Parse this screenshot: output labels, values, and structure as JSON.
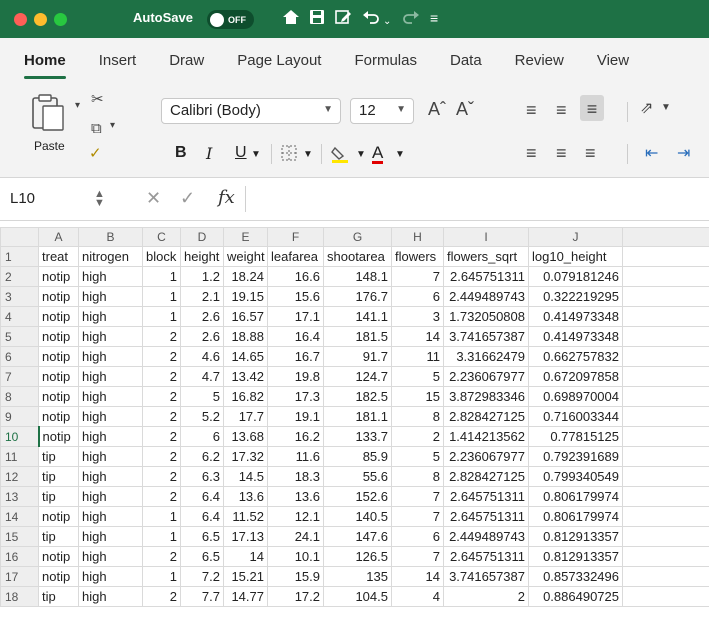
{
  "titlebar": {
    "autosave_label": "AutoSave",
    "autosave_state": "OFF",
    "icons": [
      "home-icon",
      "save-icon",
      "edit-icon",
      "undo-icon",
      "redo-icon",
      "customize-icon"
    ]
  },
  "tabs": [
    "Home",
    "Insert",
    "Draw",
    "Page Layout",
    "Formulas",
    "Data",
    "Review",
    "View"
  ],
  "active_tab": "Home",
  "ribbon": {
    "paste_label": "Paste",
    "font_name": "Calibri (Body)",
    "font_size": "12",
    "bold": "B",
    "italic": "I",
    "underline": "U",
    "grow_font": "Aˆ",
    "shrink_font": "Aˇ",
    "font_color_letter": "A",
    "font_color_hex": "#e00000",
    "highlight_hex": "#ffe600"
  },
  "formula_bar": {
    "name_box": "L10",
    "fx_label": "fx",
    "value": ""
  },
  "sheet": {
    "columns": [
      "A",
      "B",
      "C",
      "D",
      "E",
      "F",
      "G",
      "H",
      "I",
      "J"
    ],
    "selected_row": 10,
    "rows": [
      {
        "n": "1",
        "cells": [
          "treat",
          "nitrogen",
          "block",
          "height",
          "weight",
          "leafarea",
          "shootarea",
          "flowers",
          "flowers_sqrt",
          "log10_height"
        ]
      },
      {
        "n": "2",
        "cells": [
          "notip",
          "high",
          "1",
          "1.2",
          "18.24",
          "16.6",
          "148.1",
          "7",
          "2.645751311",
          "0.079181246"
        ]
      },
      {
        "n": "3",
        "cells": [
          "notip",
          "high",
          "1",
          "2.1",
          "19.15",
          "15.6",
          "176.7",
          "6",
          "2.449489743",
          "0.322219295"
        ]
      },
      {
        "n": "4",
        "cells": [
          "notip",
          "high",
          "1",
          "2.6",
          "16.57",
          "17.1",
          "141.1",
          "3",
          "1.732050808",
          "0.414973348"
        ]
      },
      {
        "n": "5",
        "cells": [
          "notip",
          "high",
          "2",
          "2.6",
          "18.88",
          "16.4",
          "181.5",
          "14",
          "3.741657387",
          "0.414973348"
        ]
      },
      {
        "n": "6",
        "cells": [
          "notip",
          "high",
          "2",
          "4.6",
          "14.65",
          "16.7",
          "91.7",
          "11",
          "3.31662479",
          "0.662757832"
        ]
      },
      {
        "n": "7",
        "cells": [
          "notip",
          "high",
          "2",
          "4.7",
          "13.42",
          "19.8",
          "124.7",
          "5",
          "2.236067977",
          "0.672097858"
        ]
      },
      {
        "n": "8",
        "cells": [
          "notip",
          "high",
          "2",
          "5",
          "16.82",
          "17.3",
          "182.5",
          "15",
          "3.872983346",
          "0.698970004"
        ]
      },
      {
        "n": "9",
        "cells": [
          "notip",
          "high",
          "2",
          "5.2",
          "17.7",
          "19.1",
          "181.1",
          "8",
          "2.828427125",
          "0.716003344"
        ]
      },
      {
        "n": "10",
        "cells": [
          "notip",
          "high",
          "2",
          "6",
          "13.68",
          "16.2",
          "133.7",
          "2",
          "1.414213562",
          "0.77815125"
        ]
      },
      {
        "n": "11",
        "cells": [
          "tip",
          "high",
          "2",
          "6.2",
          "17.32",
          "11.6",
          "85.9",
          "5",
          "2.236067977",
          "0.792391689"
        ]
      },
      {
        "n": "12",
        "cells": [
          "tip",
          "high",
          "2",
          "6.3",
          "14.5",
          "18.3",
          "55.6",
          "8",
          "2.828427125",
          "0.799340549"
        ]
      },
      {
        "n": "13",
        "cells": [
          "tip",
          "high",
          "2",
          "6.4",
          "13.6",
          "13.6",
          "152.6",
          "7",
          "2.645751311",
          "0.806179974"
        ]
      },
      {
        "n": "14",
        "cells": [
          "notip",
          "high",
          "1",
          "6.4",
          "11.52",
          "12.1",
          "140.5",
          "7",
          "2.645751311",
          "0.806179974"
        ]
      },
      {
        "n": "15",
        "cells": [
          "tip",
          "high",
          "1",
          "6.5",
          "17.13",
          "24.1",
          "147.6",
          "6",
          "2.449489743",
          "0.812913357"
        ]
      },
      {
        "n": "16",
        "cells": [
          "notip",
          "high",
          "2",
          "6.5",
          "14",
          "10.1",
          "126.5",
          "7",
          "2.645751311",
          "0.812913357"
        ]
      },
      {
        "n": "17",
        "cells": [
          "notip",
          "high",
          "1",
          "7.2",
          "15.21",
          "15.9",
          "135",
          "14",
          "3.741657387",
          "0.857332496"
        ]
      },
      {
        "n": "18",
        "cells": [
          "tip",
          "high",
          "2",
          "7.7",
          "14.77",
          "17.2",
          "104.5",
          "4",
          "2",
          "0.886490725"
        ]
      }
    ]
  }
}
